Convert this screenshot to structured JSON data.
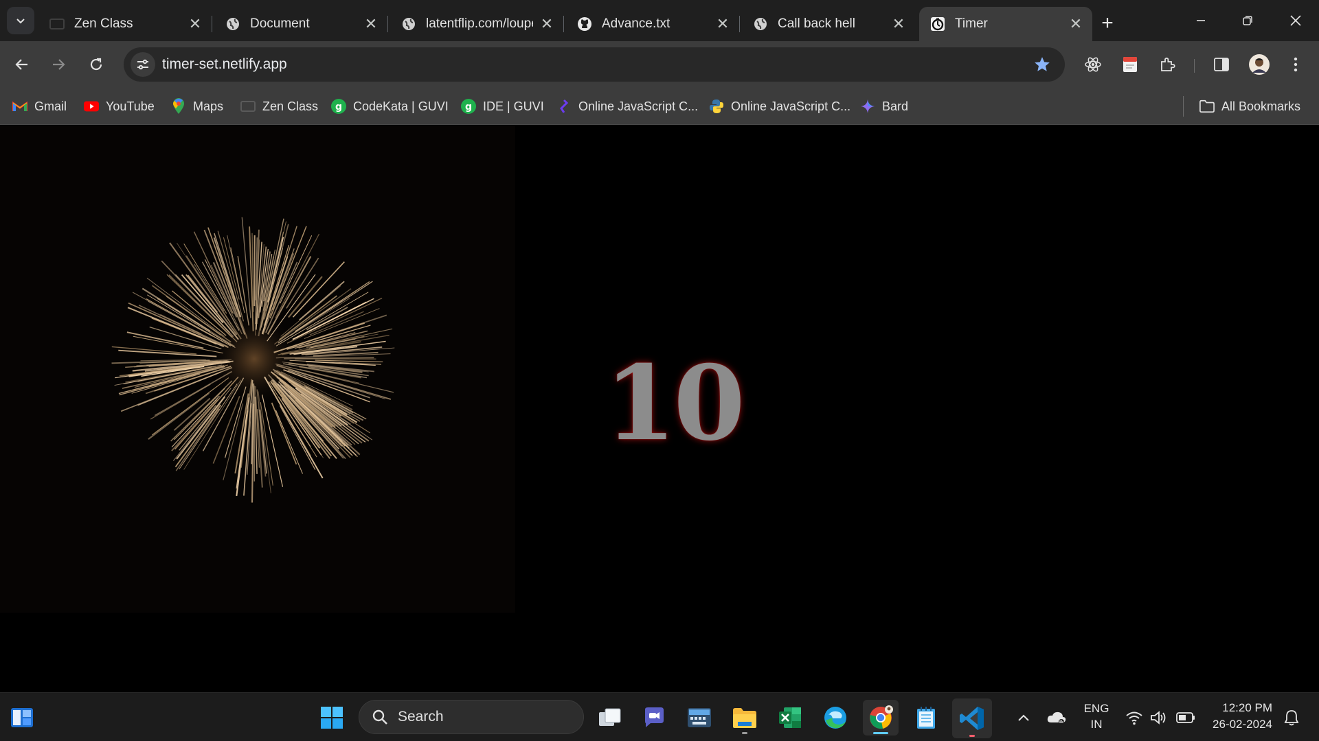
{
  "browser": {
    "tabs": [
      {
        "title": "Zen Class",
        "icon": "zen-class-icon"
      },
      {
        "title": "Document",
        "icon": "globe-icon"
      },
      {
        "title": "latentflip.com/loupe",
        "icon": "globe-icon"
      },
      {
        "title": "Advance.txt",
        "icon": "github-icon"
      },
      {
        "title": "Call back hell",
        "icon": "globe-icon"
      },
      {
        "title": "Timer",
        "icon": "timer-icon",
        "active": true
      }
    ],
    "close_glyph": "✕",
    "new_tab_glyph": "+",
    "address": "timer-set.netlify.app",
    "bookmarked": true,
    "accent_color": "#8ab4f8"
  },
  "bookmarks": {
    "items": [
      {
        "label": "Gmail",
        "icon": "gmail-icon"
      },
      {
        "label": "YouTube",
        "icon": "youtube-icon"
      },
      {
        "label": "Maps",
        "icon": "maps-icon"
      },
      {
        "label": "Zen Class",
        "icon": "zen-class-icon"
      },
      {
        "label": "CodeKata | GUVI",
        "icon": "guvi-icon"
      },
      {
        "label": "IDE | GUVI",
        "icon": "guvi-icon"
      },
      {
        "label": "Online JavaScript C...",
        "icon": "programiz-icon"
      },
      {
        "label": "Online JavaScript C...",
        "icon": "python-icon"
      },
      {
        "label": "Bard",
        "icon": "bard-icon"
      }
    ],
    "all_bookmarks": "All Bookmarks"
  },
  "page": {
    "timer_value": "10",
    "timer_color": "#8c8c8c",
    "glow_color": "#c81414",
    "media": "firework-burst"
  },
  "taskbar": {
    "search_placeholder": "Search",
    "lang_line1": "ENG",
    "lang_line2": "IN",
    "time": "12:20 PM",
    "date": "26-02-2024",
    "apps": [
      "widgets-icon",
      "windows-start-icon",
      "task-view-icon",
      "teams-chat-icon",
      "virtual-keyboard-app-icon",
      "file-explorer-icon",
      "excel-icon",
      "edge-icon",
      "chrome-icon",
      "notepad-icon",
      "vscode-icon"
    ]
  }
}
